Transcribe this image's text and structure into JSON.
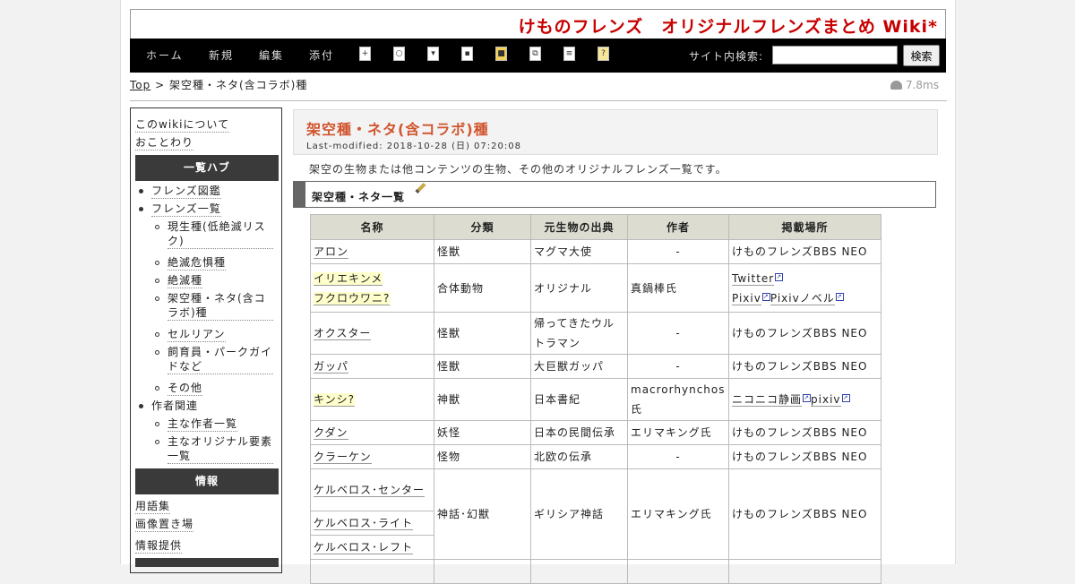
{
  "site": {
    "title": "けものフレンズ　オリジナルフレンズまとめ Wiki*"
  },
  "nav": {
    "links": [
      "ホーム",
      "新規",
      "編集",
      "添付"
    ],
    "tool_icons": [
      "new-page-icon",
      "search-page-icon",
      "import-icon",
      "save-icon",
      "lock-icon",
      "copy-icon",
      "list-icon",
      "help-icon"
    ],
    "search_label": "サイト内検索:",
    "search_value": "",
    "search_button": "検索"
  },
  "breadcrumb": {
    "top": "Top",
    "separator": ">",
    "current": "架空種・ネタ(含コラボ)種"
  },
  "timer": "7.8ms",
  "sidebar": {
    "links_top": [
      "このwikiについて",
      "おことわり"
    ],
    "heading_hub": "一覧ハブ",
    "hub_items": [
      {
        "label": "フレンズ図鑑"
      },
      {
        "label": "フレンズ一覧"
      },
      {
        "label": "現生種(低絶滅リスク)"
      },
      {
        "label": "絶滅危惧種"
      },
      {
        "label": "絶滅種"
      },
      {
        "label": "架空種・ネタ(含コラボ)種"
      },
      {
        "label": "セルリアン"
      },
      {
        "label": "飼育員・パークガイドなど"
      },
      {
        "label": "その他"
      },
      {
        "label": "作者関連"
      },
      {
        "label": "主な作者一覧"
      },
      {
        "label": "主なオリジナル要素一覧"
      }
    ],
    "heading_info": "情報",
    "info_items": [
      "用語集",
      "画像置き場",
      "情報提供"
    ]
  },
  "page": {
    "title": "架空種・ネタ(含コラボ)種",
    "modified": "Last-modified: 2018-10-28 (日) 07:20:08",
    "intro": "架空の生物または他コンテンツの生物、その他のオリジナルフレンズ一覧です。",
    "section_title": "架空種・ネタ一覧"
  },
  "table": {
    "headers": [
      "名称",
      "分類",
      "元生物の出典",
      "作者",
      "掲載場所"
    ],
    "rows": [
      {
        "name": "アロン",
        "class": "怪獣",
        "source": "マグマ大使",
        "author": "-",
        "place": "けものフレンズBBS NEO"
      },
      {
        "name": "イリエキンメ",
        "name2": "フクロウワニ?",
        "class": "合体動物",
        "source": "オリジナル",
        "author": "真鍋棒氏",
        "place_links": [
          "Twitter",
          "Pixiv",
          "Pixivノベル"
        ]
      },
      {
        "name": "オクスター",
        "class": "怪獣",
        "source": "帰ってきたウルトラマン",
        "author": "-",
        "place": "けものフレンズBBS NEO"
      },
      {
        "name": "ガッパ",
        "class": "怪獣",
        "source": "大巨獣ガッパ",
        "author": "-",
        "place": "けものフレンズBBS NEO"
      },
      {
        "name": "キンシ?",
        "class": "神獣",
        "source": "日本書紀",
        "author": "macrorhynchos氏",
        "place_links": [
          "ニコニコ静画",
          "pixiv"
        ]
      },
      {
        "name": "クダン",
        "class": "妖怪",
        "source": "日本の民間伝承",
        "author": "エリマキング氏",
        "place": "けものフレンズBBS NEO"
      },
      {
        "name": "クラーケン",
        "class": "怪物",
        "source": "北欧の伝承",
        "author": "-",
        "place": "けものフレンズBBS NEO"
      },
      {
        "name": "ケルベロス･センター",
        "class": "神話･幻獣",
        "source": "ギリシア神話",
        "author": "エリマキング氏",
        "place": "けものフレンズBBS NEO"
      },
      {
        "name": "ケルベロス･ライト"
      },
      {
        "name": "ケルベロス･レフト"
      }
    ]
  }
}
